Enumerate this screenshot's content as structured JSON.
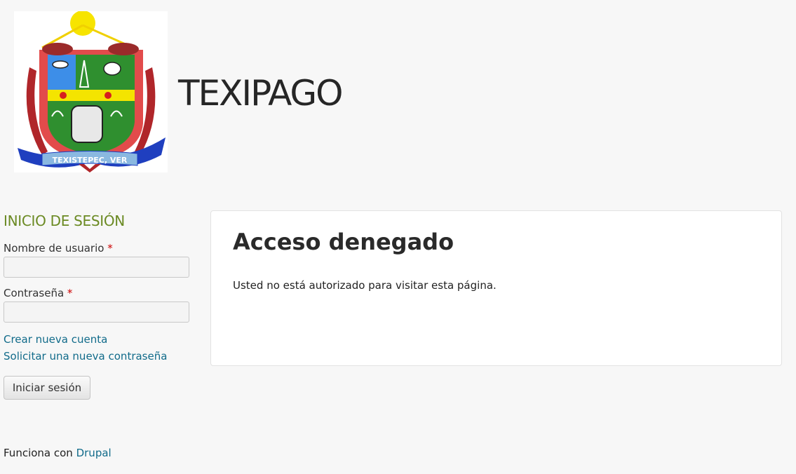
{
  "header": {
    "site_name": "TEXIPAGO",
    "logo_text": "TEXISTEPEC, VER"
  },
  "sidebar": {
    "login_block": {
      "title": "INICIO DE SESIÓN",
      "username_label": "Nombre de usuario",
      "password_label": "Contraseña",
      "required_marker": "*",
      "username_value": "",
      "password_value": "",
      "create_account_link": "Crear nueva cuenta",
      "request_password_link": "Solicitar una nueva contraseña",
      "submit_label": "Iniciar sesión"
    }
  },
  "main": {
    "title": "Acceso denegado",
    "message": "Usted no está autorizado para visitar esta página."
  },
  "footer": {
    "prefix": "Funciona con",
    "link": "Drupal"
  },
  "colors": {
    "background": "#f7f7f7",
    "block_title": "#6b8a23",
    "link": "#116b8a",
    "required": "#cc0000"
  }
}
